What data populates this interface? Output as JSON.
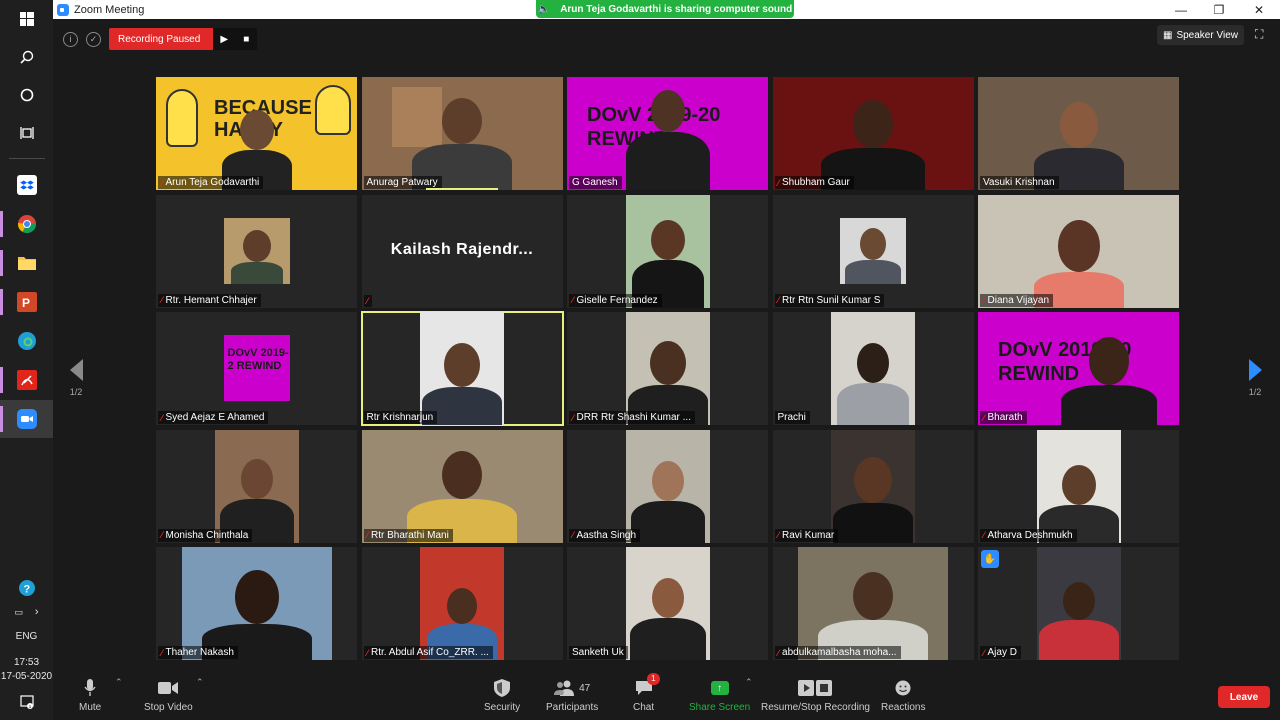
{
  "window": {
    "title": "Zoom Meeting",
    "minimize": "—",
    "restore": "❐",
    "close": "✕"
  },
  "share_banner": {
    "text": "Arun Teja Godavarthi is sharing computer sound"
  },
  "recording": {
    "status": "Recording Paused",
    "resume": "▶",
    "stop": "■"
  },
  "view": {
    "speaker_view": "Speaker View"
  },
  "pager": {
    "left": "1/2",
    "right": "1/2"
  },
  "taskbar": {
    "language": "ENG",
    "time": "17:53",
    "date": "17-05-2020"
  },
  "participants": [
    {
      "name": "Arun Teja Godavarthi",
      "muted": true
    },
    {
      "name": "Anurag Patwary",
      "muted": false
    },
    {
      "name": "G Ganesh",
      "muted": false
    },
    {
      "name": "Shubham Gaur",
      "muted": true
    },
    {
      "name": "Vasuki Krishnan",
      "muted": false
    },
    {
      "name": "Rtr. Hemant Chhajer",
      "muted": true
    },
    {
      "name": "",
      "display": "Kailash  Rajendr...",
      "muted": true
    },
    {
      "name": "Giselle Fernandez",
      "muted": true
    },
    {
      "name": "Rtr Rtn Sunil Kumar S",
      "muted": true
    },
    {
      "name": "Diana Vijayan",
      "muted": true
    },
    {
      "name": "Syed Aejaz E Ahamed",
      "muted": true
    },
    {
      "name": "Rtr Krishnarjun",
      "muted": false
    },
    {
      "name": "DRR Rtr Shashi Kumar ...",
      "muted": true
    },
    {
      "name": "Prachi",
      "muted": false
    },
    {
      "name": "Bharath",
      "muted": true
    },
    {
      "name": "Monisha Chinthala",
      "muted": true
    },
    {
      "name": "Rtr Bharathi Mani",
      "muted": true
    },
    {
      "name": "Aastha Singh",
      "muted": true
    },
    {
      "name": "Ravi Kumar",
      "muted": true
    },
    {
      "name": "Atharva Deshmukh",
      "muted": true
    },
    {
      "name": "Thaher Nakash",
      "muted": true
    },
    {
      "name": "Rtr. Abdul Asif Co_ZRR. ...",
      "muted": true
    },
    {
      "name": "Sanketh Uk",
      "muted": false
    },
    {
      "name": "abdulkamalbasha moha...",
      "muted": true
    },
    {
      "name": "Ajay D",
      "muted": true
    }
  ],
  "posters": {
    "minions": "BECAUSE HAPPY",
    "dovv_a": "DOvV 2019-20 REWIND",
    "dovv_b": "DOvV 2019-2 REWIND",
    "dovv_c": "DOvV 2019-20 REWIND"
  },
  "toolbar": {
    "mute": "Mute",
    "stop_video": "Stop Video",
    "security": "Security",
    "participants": "Participants",
    "participants_count": "47",
    "chat": "Chat",
    "chat_badge": "1",
    "share_screen": "Share Screen",
    "recording": "Resume/Stop Recording",
    "reactions": "Reactions",
    "leave": "Leave"
  },
  "colors": {
    "zoom_blue": "#2d8cff",
    "record_red": "#e02828",
    "share_green": "#23b23f",
    "active_speaker": "#e7f07a",
    "poster_magenta": "#cc00cc"
  }
}
